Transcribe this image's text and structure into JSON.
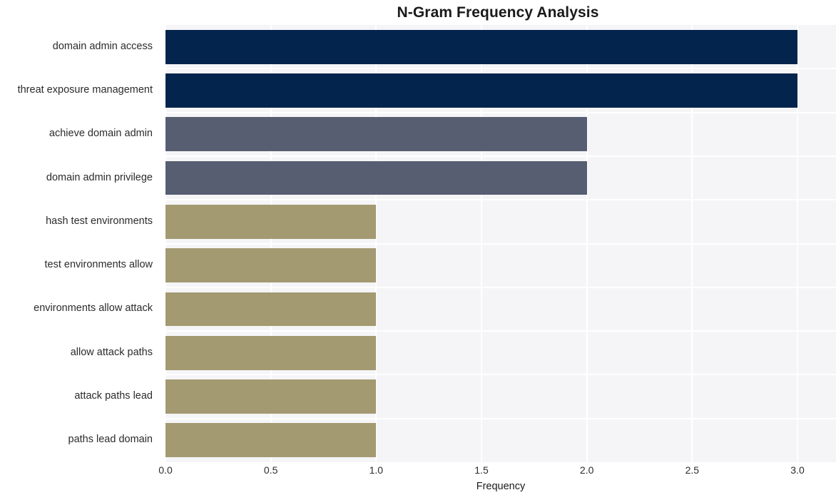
{
  "chart_data": {
    "type": "bar",
    "orientation": "horizontal",
    "title": "N-Gram Frequency Analysis",
    "xlabel": "Frequency",
    "ylabel": "",
    "xlim": [
      0.0,
      3.0
    ],
    "grid": true,
    "legend": null,
    "categories": [
      "domain admin access",
      "threat exposure management",
      "achieve domain admin",
      "domain admin privilege",
      "hash test environments",
      "test environments allow",
      "environments allow attack",
      "allow attack paths",
      "attack paths lead",
      "paths lead domain"
    ],
    "values": [
      3,
      3,
      2,
      2,
      1,
      1,
      1,
      1,
      1,
      1
    ],
    "bar_colors": [
      "#03244d",
      "#03244d",
      "#575e72",
      "#575e72",
      "#a39a72",
      "#a39a72",
      "#a39a72",
      "#a39a72",
      "#a39a72",
      "#a39a72"
    ],
    "xticks": [
      {
        "value": 0.0,
        "label": "0.0"
      },
      {
        "value": 0.5,
        "label": "0.5"
      },
      {
        "value": 1.0,
        "label": "1.0"
      },
      {
        "value": 1.5,
        "label": "1.5"
      },
      {
        "value": 2.0,
        "label": "2.0"
      },
      {
        "value": 2.5,
        "label": "2.5"
      },
      {
        "value": 3.0,
        "label": "3.0"
      }
    ]
  },
  "style": {
    "figure_background": "#ffffff",
    "plot_background": "#f5f5f7",
    "gridline_color": "#ffffff",
    "title_color": "#1a1a1a",
    "tick_label_color": "#2b2b2b"
  }
}
